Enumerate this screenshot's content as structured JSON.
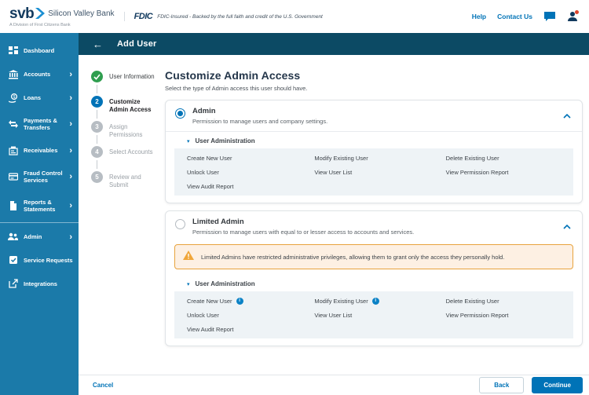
{
  "colors": {
    "brand_blue": "#0073b7",
    "sidebar_bg": "#1b7aa9",
    "topbar_bg": "#0c4a64",
    "logo_navy": "#123a5e",
    "step_completed_green": "#2f9e4f",
    "step_pending_gray": "#b7bdc3",
    "perm_area_bg": "#eef3f6",
    "warning_border": "#e8a33d",
    "warning_bg": "#fdf0e3",
    "notification_red": "#e0472e"
  },
  "icons": {
    "back_arrow": "←",
    "chevron_right": "›",
    "section_caret": "▾",
    "info_glyph": "i"
  },
  "header": {
    "logo_text": "svb",
    "bank_name": "Silicon Valley Bank",
    "division": "A Division of First Citizens Bank",
    "fdic_label": "FDIC",
    "fdic_text": "FDIC-Insured - Backed by the full faith and credit of the U.S. Government",
    "help": "Help",
    "contact": "Contact Us"
  },
  "topbar": {
    "title": "Add User"
  },
  "sidebar": {
    "items": [
      {
        "label": "Dashboard",
        "expandable": false
      },
      {
        "label": "Accounts",
        "expandable": true
      },
      {
        "label": "Loans",
        "expandable": true
      },
      {
        "label": "Payments & Transfers",
        "expandable": true
      },
      {
        "label": "Receivables",
        "expandable": true
      },
      {
        "label": "Fraud Control Services",
        "expandable": true
      },
      {
        "label": "Reports & Statements",
        "expandable": true
      },
      {
        "label": "Admin",
        "expandable": true
      },
      {
        "label": "Service Requests",
        "expandable": false
      },
      {
        "label": "Integrations",
        "expandable": false
      }
    ]
  },
  "stepper": {
    "steps": [
      {
        "number": "1",
        "label": "User Information",
        "state": "completed"
      },
      {
        "number": "2",
        "label": "Customize Admin Access",
        "state": "active"
      },
      {
        "number": "3",
        "label": "Assign Permissions",
        "state": "pending"
      },
      {
        "number": "4",
        "label": "Select Accounts",
        "state": "pending"
      },
      {
        "number": "5",
        "label": "Review and Submit",
        "state": "pending"
      }
    ]
  },
  "main": {
    "title": "Customize Admin Access",
    "subtitle": "Select the type of Admin access this user should have.",
    "admin_card": {
      "title": "Admin",
      "description": "Permission to manage users and company settings.",
      "selected": true,
      "section": "User Administration",
      "rows": [
        [
          "Create New User",
          "Modify Existing User",
          "Delete Existing User"
        ],
        [
          "Unlock User",
          "View User List",
          "View Permission Report"
        ],
        [
          "View Audit Report"
        ]
      ]
    },
    "limited_card": {
      "title": "Limited Admin",
      "description": "Permission to manage users with equal to or lesser access to accounts and services.",
      "selected": false,
      "warning": "Limited Admins have restricted administrative privileges, allowing them to grant only the access they personally hold.",
      "section": "User Administration",
      "rows": [
        [
          "Create New User",
          "Modify Existing User",
          "Delete Existing User"
        ],
        [
          "Unlock User",
          "View User List",
          "View Permission Report"
        ],
        [
          "View Audit Report"
        ]
      ]
    }
  },
  "footer": {
    "cancel": "Cancel",
    "back": "Back",
    "continue": "Continue"
  }
}
